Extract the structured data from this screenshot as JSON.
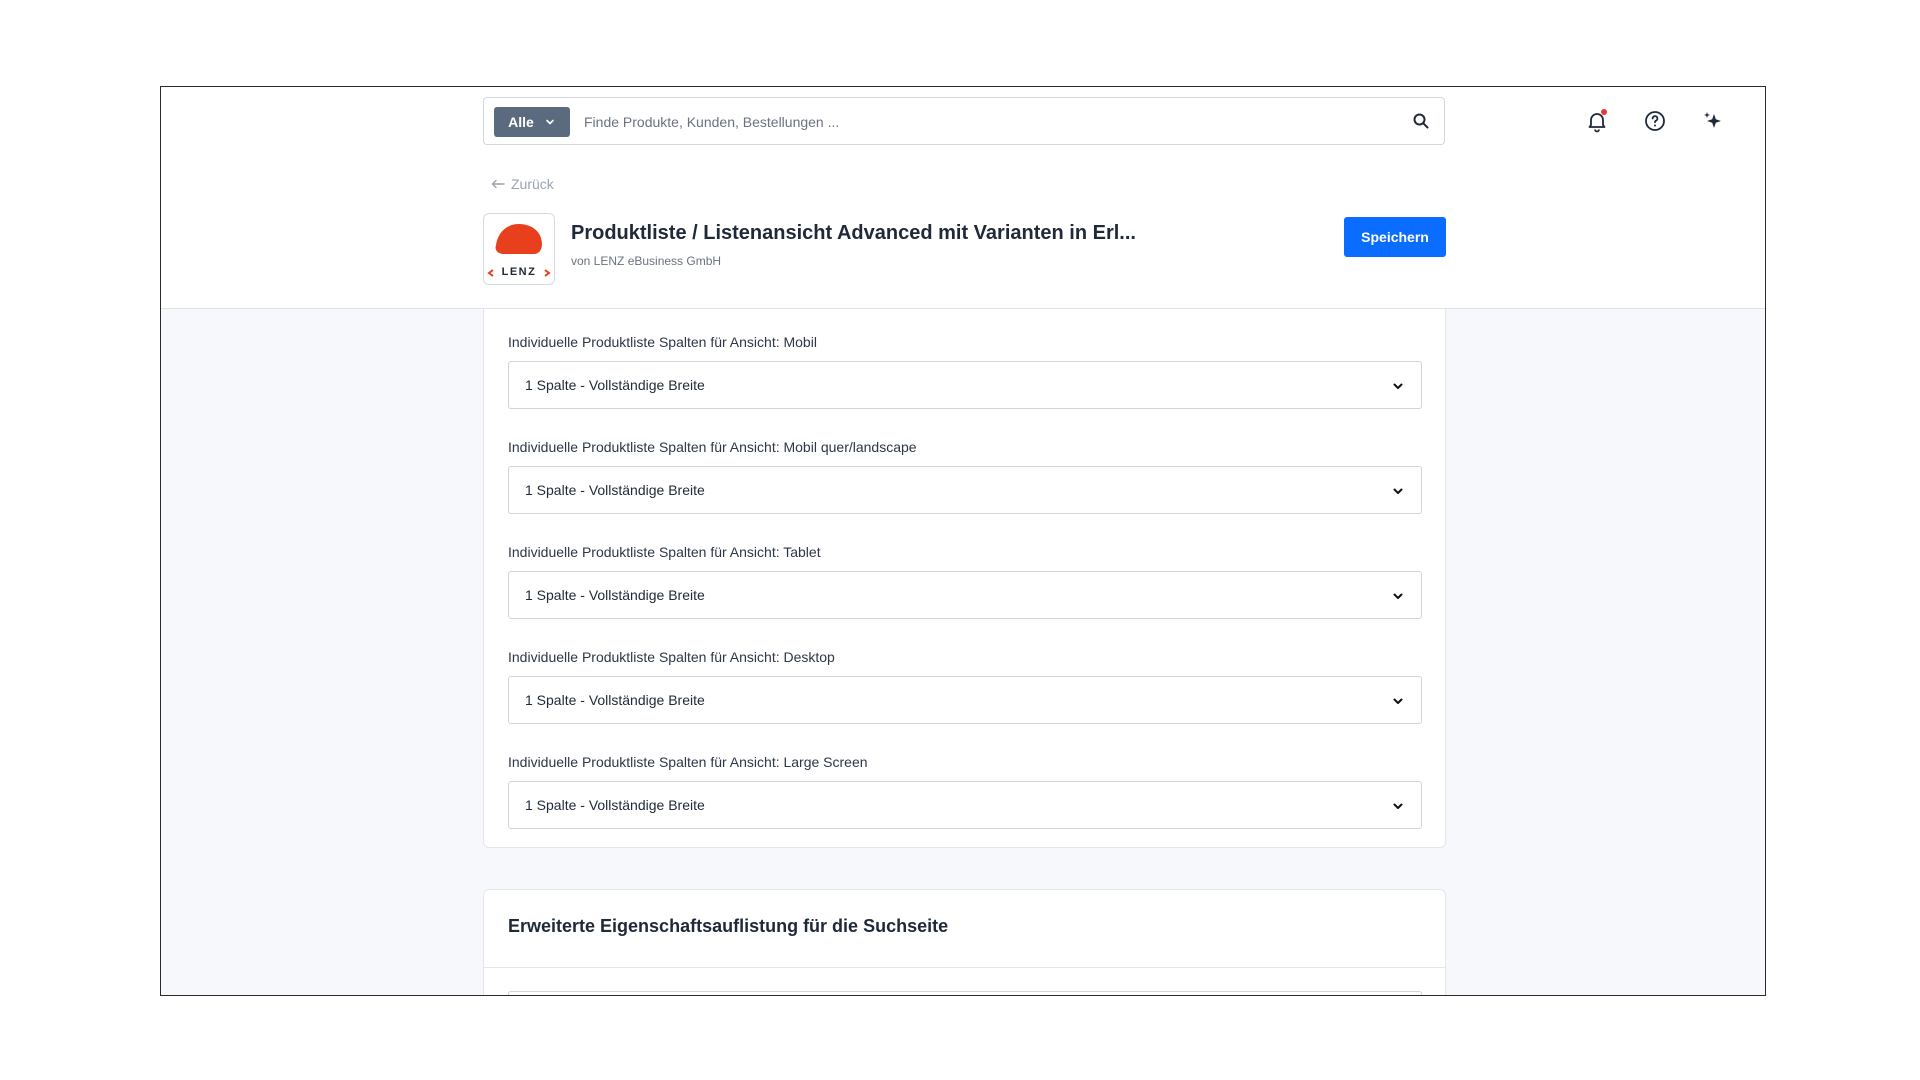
{
  "search": {
    "scope_label": "Alle",
    "placeholder": "Finde Produkte, Kunden, Bestellungen ...",
    "value": ""
  },
  "header": {
    "back_label": "Zurück",
    "title": "Produktliste / Listenansicht Advanced mit Varianten in Erl...",
    "subtitle": "von LENZ eBusiness GmbH",
    "logo_text": "LENZ",
    "save_label": "Speichern"
  },
  "fields": [
    {
      "label": "Individuelle Produktliste Spalten für Ansicht: Mobil",
      "value": "1 Spalte - Vollständige Breite"
    },
    {
      "label": "Individuelle Produktliste Spalten für Ansicht: Mobil quer/landscape",
      "value": "1 Spalte - Vollständige Breite"
    },
    {
      "label": "Individuelle Produktliste Spalten für Ansicht: Tablet",
      "value": "1 Spalte - Vollständige Breite"
    },
    {
      "label": "Individuelle Produktliste Spalten für Ansicht: Desktop",
      "value": "1 Spalte - Vollständige Breite"
    },
    {
      "label": "Individuelle Produktliste Spalten für Ansicht: Large Screen",
      "value": "1 Spalte - Vollständige Breite"
    }
  ],
  "section2": {
    "title": "Erweiterte Eigenschaftsauflistung für die Suchseite"
  },
  "colors": {
    "accent": "#0a6dff",
    "scope_bg": "#5a6b7f",
    "logo_red": "#e8401c",
    "notification_dot": "#e53935"
  }
}
